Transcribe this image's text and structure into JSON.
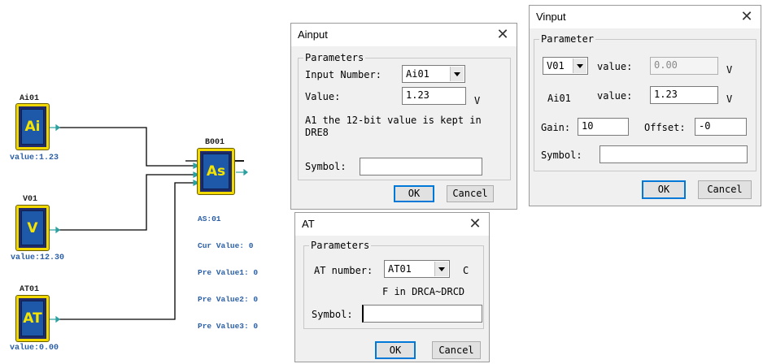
{
  "canvas": {
    "ai_block": {
      "label": "Ai01",
      "text": "Ai",
      "value": "value:1.23"
    },
    "v_block": {
      "label": "V01",
      "text": "V",
      "value": "value:12.30"
    },
    "at_block": {
      "label": "AT01",
      "text": "AT",
      "value": "value:0.00"
    },
    "as_block": {
      "label": "B001",
      "text": "As",
      "info": [
        "AS:01",
        "Cur Value: 0",
        "Pre Value1: 0",
        "Pre Value2: 0",
        "Pre Value3: 0"
      ]
    }
  },
  "ainput": {
    "title": "Ainput",
    "group": "Parameters",
    "input_number_label": "Input Number:",
    "input_number_value": "Ai01",
    "value_label": "Value:",
    "value_value": "1.23",
    "value_unit": "V",
    "note_line1": "A1 the 12-bit value is kept in",
    "note_line2": "DRE8",
    "symbol_label": "Symbol:",
    "symbol_value": "",
    "ok": "OK",
    "cancel": "Cancel"
  },
  "at": {
    "title": "AT",
    "group": "Parameters",
    "at_number_label": "AT number:",
    "at_number_value": "AT01",
    "unit": "C",
    "note": "F in DRCA~DRCD",
    "symbol_label": "Symbol:",
    "symbol_value": "",
    "ok": "OK",
    "cancel": "Cancel"
  },
  "vinput": {
    "title": "Vinput",
    "group": "Parameter",
    "v_select_value": "V01",
    "value_label_1": "value:",
    "value_1": "0.00",
    "unit_1": "V",
    "ai_label": "Ai01",
    "value_label_2": "value:",
    "value_2": "1.23",
    "unit_2": "V",
    "gain_label": "Gain:",
    "gain_value": "10",
    "offset_label": "Offset:",
    "offset_value": "-0",
    "symbol_label": "Symbol:",
    "symbol_value": "",
    "ok": "OK",
    "cancel": "Cancel"
  }
}
